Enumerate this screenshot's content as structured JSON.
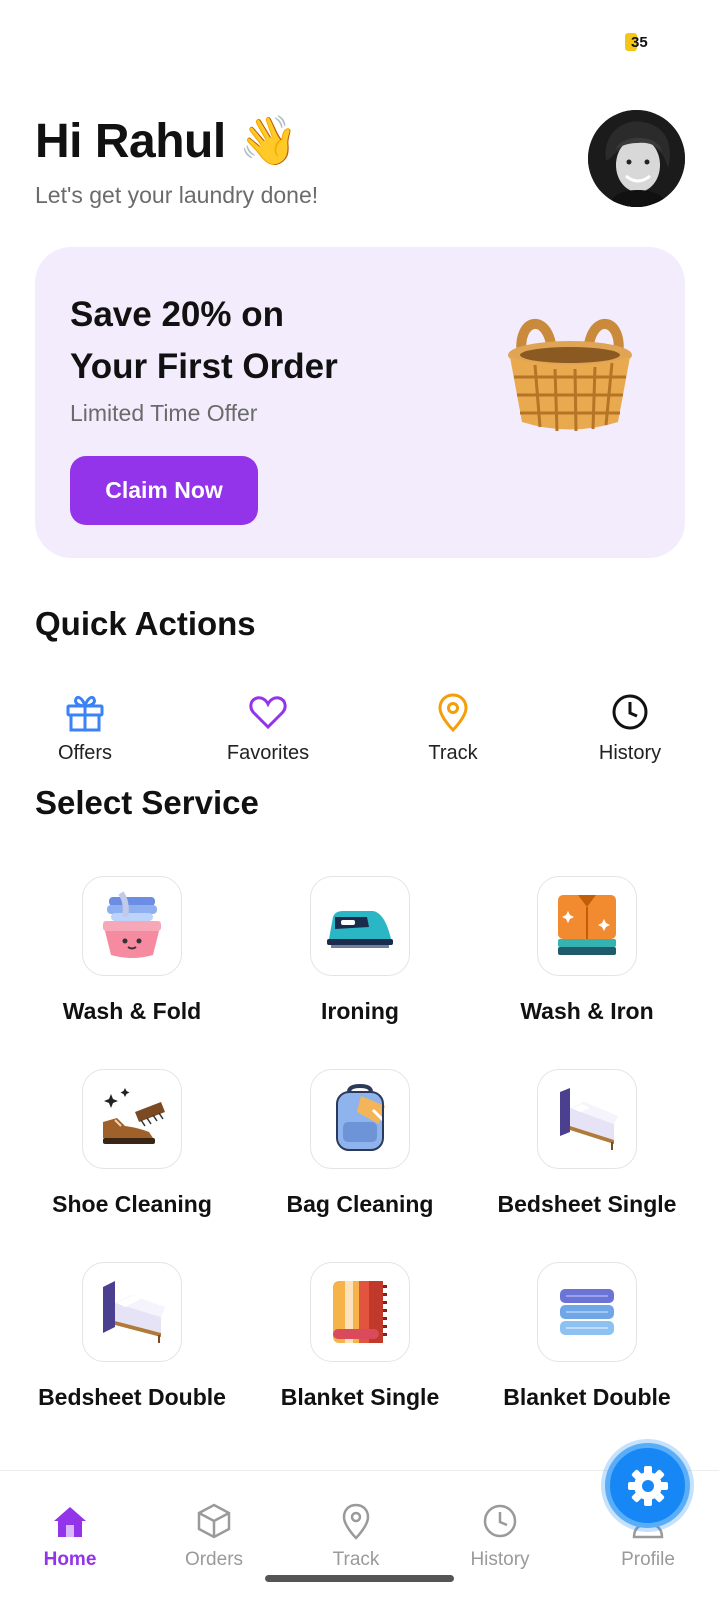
{
  "status": {
    "badge_count": "35"
  },
  "header": {
    "greeting": "Hi Rahul 👋",
    "subtitle": "Let's get your laundry done!"
  },
  "promo": {
    "title": "Save 20% on\nYour First Order",
    "subtitle": "Limited Time Offer",
    "button_label": "Claim Now",
    "accent_color": "#9333ea",
    "background_color": "#f3ecfd",
    "image_icon": "basket-icon"
  },
  "quick_actions": {
    "title": "Quick Actions",
    "items": [
      {
        "label": "Offers",
        "icon": "gift-icon",
        "color": "#3b82f6"
      },
      {
        "label": "Favorites",
        "icon": "heart-icon",
        "color": "#9333ea"
      },
      {
        "label": "Track",
        "icon": "location-pin-icon",
        "color": "#f59e0b"
      },
      {
        "label": "History",
        "icon": "clock-icon",
        "color": "#111111"
      }
    ]
  },
  "services": {
    "title": "Select Service",
    "items": [
      {
        "label": "Wash & Fold",
        "icon": "laundry-basket-icon"
      },
      {
        "label": "Ironing",
        "icon": "iron-icon"
      },
      {
        "label": "Wash & Iron",
        "icon": "folded-shirt-icon"
      },
      {
        "label": "Shoe Cleaning",
        "icon": "shoe-brush-icon"
      },
      {
        "label": "Bag Cleaning",
        "icon": "backpack-icon"
      },
      {
        "label": "Bedsheet Single",
        "icon": "single-bed-icon"
      },
      {
        "label": "Bedsheet Double",
        "icon": "double-bed-icon"
      },
      {
        "label": "Blanket Single",
        "icon": "blanket-icon"
      },
      {
        "label": "Blanket Double",
        "icon": "stacked-blankets-icon"
      }
    ]
  },
  "bottom_nav": {
    "items": [
      {
        "label": "Home",
        "icon": "home-icon",
        "active": true
      },
      {
        "label": "Orders",
        "icon": "box-icon",
        "active": false
      },
      {
        "label": "Track",
        "icon": "location-pin-icon",
        "active": false
      },
      {
        "label": "History",
        "icon": "clock-icon",
        "active": false
      },
      {
        "label": "Profile",
        "icon": "person-icon",
        "active": false
      }
    ],
    "active_color": "#9333ea",
    "inactive_color": "#9a9a9a"
  },
  "fab": {
    "icon": "gear-icon",
    "color": "#1787f5"
  }
}
